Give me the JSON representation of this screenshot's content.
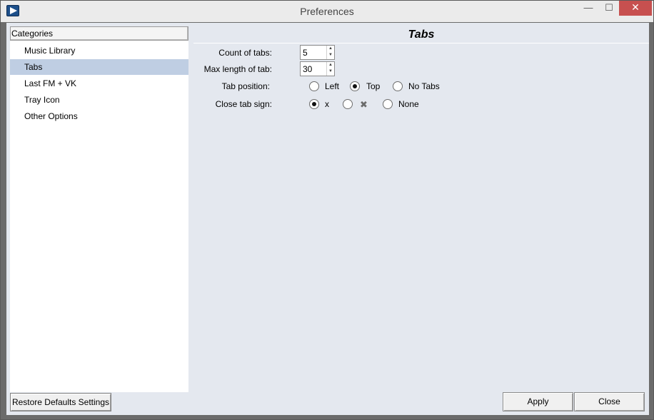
{
  "window": {
    "title": "Preferences",
    "minimize_glyph": "—",
    "maximize_glyph": "☐",
    "close_glyph": "✕"
  },
  "categories": {
    "header": "Categories",
    "items": [
      {
        "label": "Music Library",
        "selected": false
      },
      {
        "label": "Tabs",
        "selected": true
      },
      {
        "label": "Last FM + VK",
        "selected": false
      },
      {
        "label": "Tray Icon",
        "selected": false
      },
      {
        "label": "Other Options",
        "selected": false
      }
    ]
  },
  "tabs_page": {
    "title": "Tabs",
    "count_of_tabs": {
      "label": "Count of tabs:",
      "value": "5"
    },
    "max_length_of_tab": {
      "label": "Max length of tab:",
      "value": "30"
    },
    "tab_position": {
      "label": "Tab position:",
      "options": [
        {
          "label": "Left",
          "checked": false
        },
        {
          "label": "Top",
          "checked": true
        },
        {
          "label": "No Tabs",
          "checked": false
        }
      ]
    },
    "close_tab_sign": {
      "label": "Close tab sign:",
      "options": [
        {
          "label": "x",
          "checked": true
        },
        {
          "label": "",
          "icon": "close-x-icon",
          "checked": false
        },
        {
          "label": "None",
          "checked": false
        }
      ]
    }
  },
  "buttons": {
    "restore_defaults": "Restore Defaults Settings",
    "apply": "Apply",
    "close": "Close"
  },
  "colors": {
    "selection": "#bfcee3",
    "client_background": "#e4e8ef",
    "close_button": "#c7504f"
  }
}
